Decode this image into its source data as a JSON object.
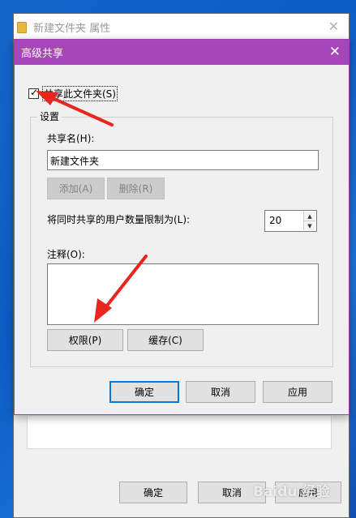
{
  "background_window": {
    "title": "新建文件夹 属性",
    "ok_label": "确定",
    "cancel_label": "取消",
    "apply_label": "应用"
  },
  "dialog": {
    "title": "高级共享",
    "share_checkbox_label": "共享此文件夹(S)",
    "share_checked": true,
    "settings_group_label": "设置",
    "share_name_label": "共享名(H):",
    "share_name_value": "新建文件夹",
    "add_label": "添加(A)",
    "remove_label": "删除(R)",
    "user_limit_label": "将同时共享的用户数量限制为(L):",
    "user_limit_value": "20",
    "comment_label": "注释(O):",
    "comment_value": "",
    "permissions_label": "权限(P)",
    "caching_label": "缓存(C)",
    "ok_label": "确定",
    "cancel_label": "取消",
    "apply_label": "应用"
  },
  "icons": {
    "folder": "folder-icon",
    "close": "close-icon",
    "check": "✓",
    "up": "▲",
    "down": "▼"
  },
  "watermark": "Baidu 经验",
  "colors": {
    "dialog_titlebar": "#a746ba",
    "desktop": "#1565c9",
    "arrow": "#e8261e",
    "primary_focus": "#0078d7"
  }
}
